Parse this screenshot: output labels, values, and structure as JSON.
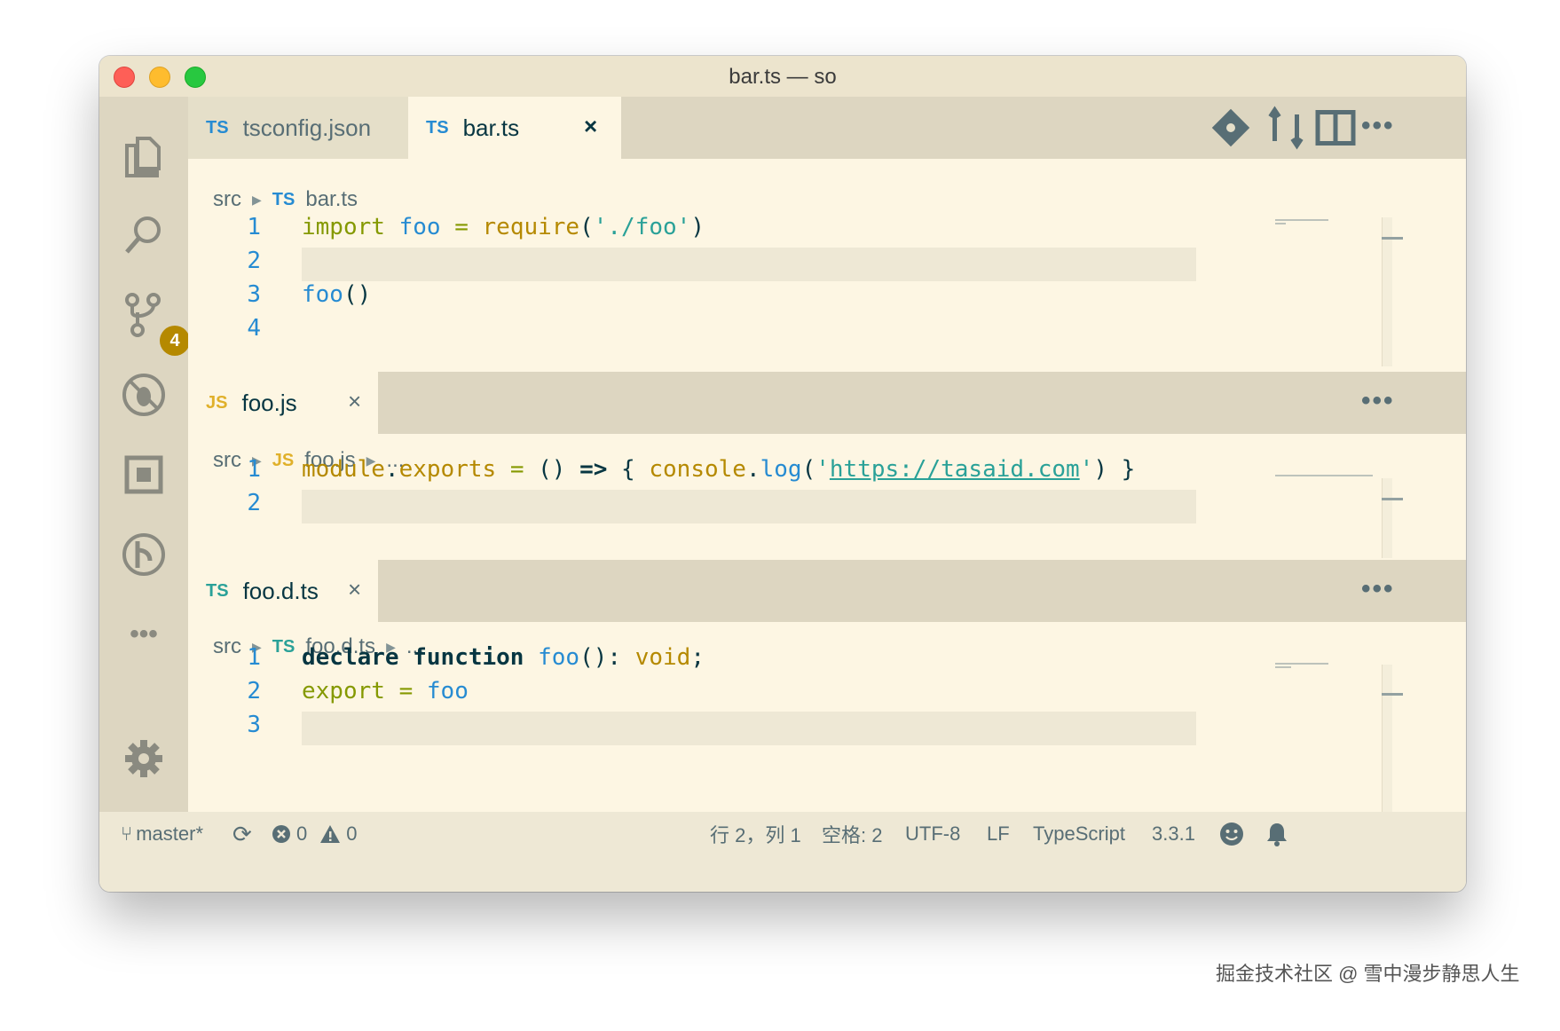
{
  "window": {
    "title": "bar.ts — so"
  },
  "activity": {
    "icons": [
      "files-icon",
      "search-icon",
      "source-control-icon",
      "debug-icon",
      "extensions-icon",
      "remote-icon",
      "more-icon",
      "settings-icon"
    ],
    "scm_badge": "4",
    "more_label": "•••"
  },
  "group1": {
    "tabs": [
      {
        "lang": "TS",
        "label": "tsconfig.json"
      },
      {
        "lang": "TS",
        "label": "bar.ts",
        "close": "×"
      }
    ],
    "toolbar_more": "•••",
    "breadcrumb": {
      "folder": "src",
      "lang": "TS",
      "file": "bar.ts"
    },
    "lines": [
      {
        "n": "1",
        "tokens": [
          [
            "k-green",
            "import"
          ],
          [
            "k-dark",
            " "
          ],
          [
            "k-blue",
            "foo"
          ],
          [
            "k-dark",
            " "
          ],
          [
            "k-green",
            "="
          ],
          [
            "k-dark",
            " "
          ],
          [
            "k-yellow",
            "require"
          ],
          [
            "k-dark",
            "("
          ],
          [
            "k-cyan",
            "'./foo'"
          ],
          [
            "k-dark",
            ")"
          ]
        ]
      },
      {
        "n": "2",
        "tokens": []
      },
      {
        "n": "3",
        "tokens": [
          [
            "k-blue",
            "foo"
          ],
          [
            "k-dark",
            "()"
          ]
        ]
      },
      {
        "n": "4",
        "tokens": []
      }
    ]
  },
  "group2": {
    "tab": {
      "lang": "JS",
      "label": "foo.js",
      "close": "×"
    },
    "toolbar_more": "•••",
    "breadcrumb": {
      "folder": "src",
      "lang": "JS",
      "file": "foo.js",
      "more": "..."
    },
    "lines": [
      {
        "n": "1",
        "tokens": [
          [
            "k-yellow",
            "module"
          ],
          [
            "k-dark",
            "."
          ],
          [
            "k-yellow",
            "exports"
          ],
          [
            "k-dark",
            " "
          ],
          [
            "k-green",
            "="
          ],
          [
            "k-dark",
            " () "
          ],
          [
            "k-bold",
            "=>"
          ],
          [
            "k-dark",
            " { "
          ],
          [
            "k-yellow",
            "console"
          ],
          [
            "k-dark",
            "."
          ],
          [
            "k-blue",
            "log"
          ],
          [
            "k-dark",
            "("
          ],
          [
            "k-cyan",
            "'"
          ],
          [
            "k-cyan link",
            "https://tasaid.com"
          ],
          [
            "k-cyan",
            "'"
          ],
          [
            "k-dark",
            ") }"
          ]
        ]
      },
      {
        "n": "2",
        "tokens": []
      }
    ]
  },
  "group3": {
    "tab": {
      "lang": "TS",
      "label": "foo.d.ts",
      "close": "×"
    },
    "toolbar_more": "•••",
    "breadcrumb": {
      "folder": "src",
      "lang": "TS",
      "file": "foo.d.ts",
      "more": "..."
    },
    "lines": [
      {
        "n": "1",
        "tokens": [
          [
            "k-bold",
            "declare"
          ],
          [
            "k-dark",
            " "
          ],
          [
            "k-bold",
            "function"
          ],
          [
            "k-dark",
            " "
          ],
          [
            "k-blue",
            "foo"
          ],
          [
            "k-dark",
            "(): "
          ],
          [
            "k-yellow",
            "void"
          ],
          [
            "k-dark",
            ";"
          ]
        ]
      },
      {
        "n": "2",
        "tokens": [
          [
            "k-green",
            "export"
          ],
          [
            "k-dark",
            " "
          ],
          [
            "k-green",
            "="
          ],
          [
            "k-dark",
            " "
          ],
          [
            "k-blue",
            "foo"
          ]
        ]
      },
      {
        "n": "3",
        "tokens": []
      }
    ]
  },
  "statusbar": {
    "branch": "master*",
    "errors": "0",
    "warnings": "0",
    "position": "行 2，列 1",
    "indent": "空格: 2",
    "encoding": "UTF-8",
    "eol": "LF",
    "language": "TypeScript",
    "version": "3.3.1"
  },
  "watermark": "掘金技术社区 @ 雪中漫步静思人生",
  "colors": {
    "background": "#fdf6e3",
    "accent": "#268bd2",
    "badge": "#b58900"
  }
}
